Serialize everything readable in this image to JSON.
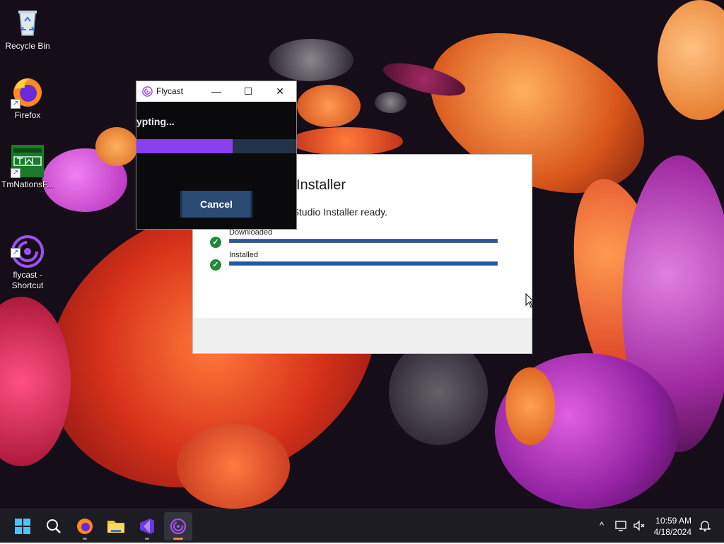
{
  "desktop": {
    "icons": [
      {
        "label": "Recycle Bin"
      },
      {
        "label": "Firefox"
      },
      {
        "label": "TmNationsF..."
      },
      {
        "label": "flycast -\nShortcut"
      }
    ]
  },
  "vs_installer": {
    "title": "Installer",
    "message": "ual Studio Installer ready.",
    "rows": [
      {
        "label": "Downloaded",
        "progress": 1.0
      },
      {
        "label": "Installed",
        "progress": 1.0
      }
    ]
  },
  "flycast": {
    "title": "Flycast",
    "status": "ypting...",
    "progress": 0.6,
    "cancel_label": "Cancel",
    "minimize": "—",
    "maximize": "☐",
    "close": "✕"
  },
  "taskbar": {
    "time": "10:59 AM",
    "date": "4/18/2024"
  },
  "colors": {
    "accent_purple": "#8a3ff0",
    "cancel_blue": "#2a4a74",
    "vs_bar": "#1e5aa8"
  }
}
